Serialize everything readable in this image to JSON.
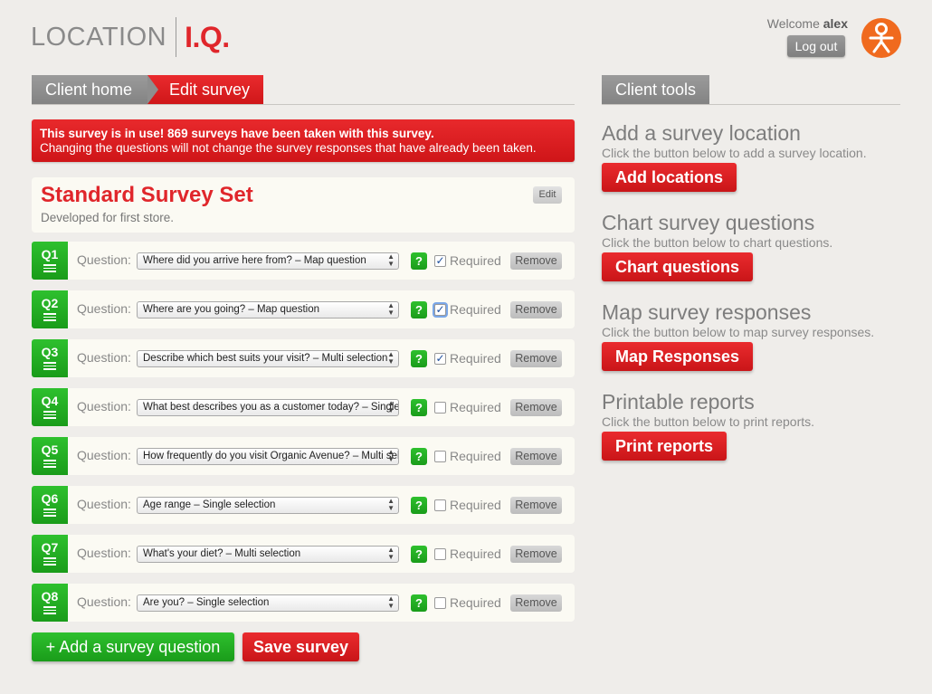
{
  "header": {
    "logo_left": "LOCATION",
    "logo_right": "I.Q.",
    "welcome_prefix": "Welcome",
    "username": "alex",
    "logout_label": "Log out"
  },
  "tabs": [
    {
      "label": "Client home"
    },
    {
      "label": "Edit survey"
    }
  ],
  "tools_tab": "Client tools",
  "alert": {
    "line1": "This survey is in use! 869 surveys have been taken with this survey.",
    "line2": "Changing the questions will not change the survey responses that have already been taken."
  },
  "survey": {
    "title": "Standard Survey Set",
    "subtitle": "Developed for first store.",
    "edit_label": "Edit"
  },
  "question_label": "Question:",
  "required_label": "Required",
  "remove_label": "Remove",
  "help_label": "?",
  "questions": [
    {
      "num": "Q1",
      "value": "Where did you arrive here from? – Map question",
      "required": true
    },
    {
      "num": "Q2",
      "value": "Where are you going? – Map question",
      "required": true
    },
    {
      "num": "Q3",
      "value": "Describe which best suits your visit? – Multi selection",
      "required": true
    },
    {
      "num": "Q4",
      "value": "What best describes you as a customer today? – Single selection",
      "required": false
    },
    {
      "num": "Q5",
      "value": "How frequently do you visit Organic Avenue? – Multi selection",
      "required": false
    },
    {
      "num": "Q6",
      "value": "Age range – Single selection",
      "required": false
    },
    {
      "num": "Q7",
      "value": "What's your diet? – Multi selection",
      "required": false
    },
    {
      "num": "Q8",
      "value": "Are you? – Single selection",
      "required": false
    }
  ],
  "actions": {
    "add_question": "+ Add a survey question",
    "save": "Save survey"
  },
  "tools": [
    {
      "title": "Add a survey location",
      "desc": "Click the button below to add a survey location.",
      "button": "Add locations"
    },
    {
      "title": "Chart survey questions",
      "desc": "Click the button below to chart questions.",
      "button": "Chart questions"
    },
    {
      "title": "Map survey responses",
      "desc": "Click the button below to map survey responses.",
      "button": "Map Responses"
    },
    {
      "title": "Printable reports",
      "desc": "Click the button below to print reports.",
      "button": "Print reports"
    }
  ],
  "colors": {
    "brand_red": "#e0262b",
    "green": "#1fa81f",
    "avatar": "#f06a1e",
    "background": "#efedea"
  }
}
